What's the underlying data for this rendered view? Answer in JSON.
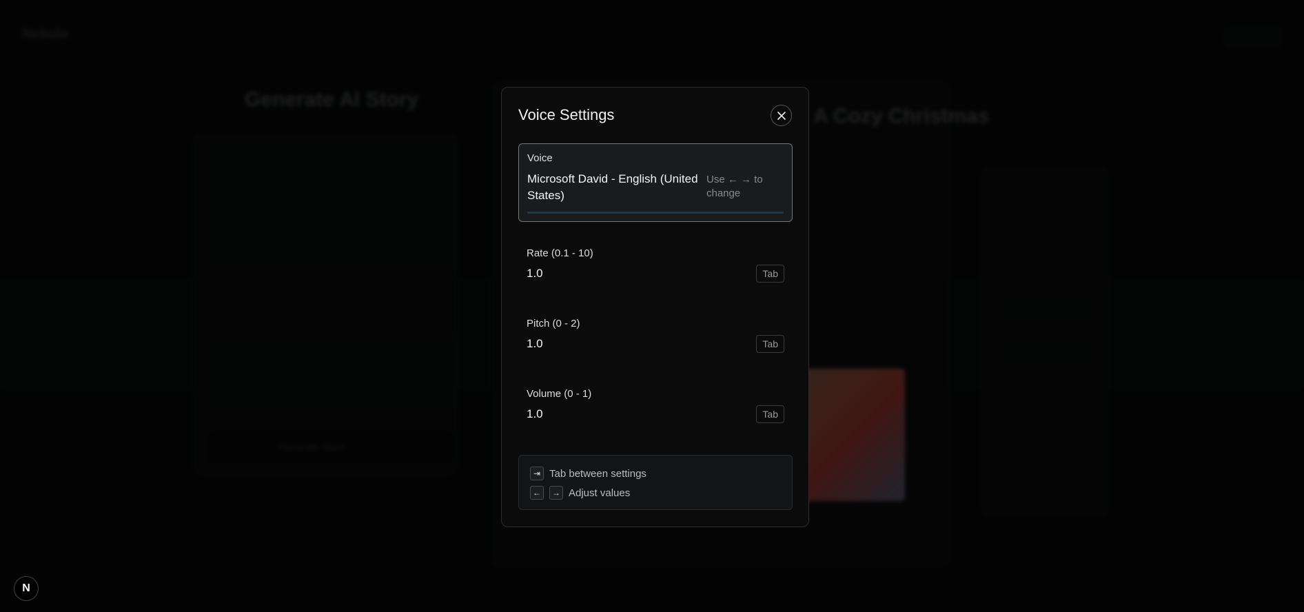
{
  "modal": {
    "title": "Voice Settings",
    "voice": {
      "label": "Voice",
      "value": "Microsoft David - English (United States)",
      "hint": "Use ← → to change"
    },
    "rate": {
      "label": "Rate (0.1 - 10)",
      "value": "1.0",
      "badge": "Tab"
    },
    "pitch": {
      "label": "Pitch (0 - 2)",
      "value": "1.0",
      "badge": "Tab"
    },
    "volume": {
      "label": "Volume (0 - 1)",
      "value": "1.0",
      "badge": "Tab"
    },
    "help": {
      "tab_key": "⇥",
      "tab_text": "Tab between settings",
      "left_key": "←",
      "right_key": "→",
      "adjust_text": "Adjust values"
    }
  },
  "background": {
    "brand": "Nebula",
    "generate_title": "Generate AI Story",
    "story_title": "A Cozy Christmas",
    "generate_button": "Generate Story"
  },
  "devtools_badge": "N",
  "icons": {
    "close": "close-icon"
  }
}
